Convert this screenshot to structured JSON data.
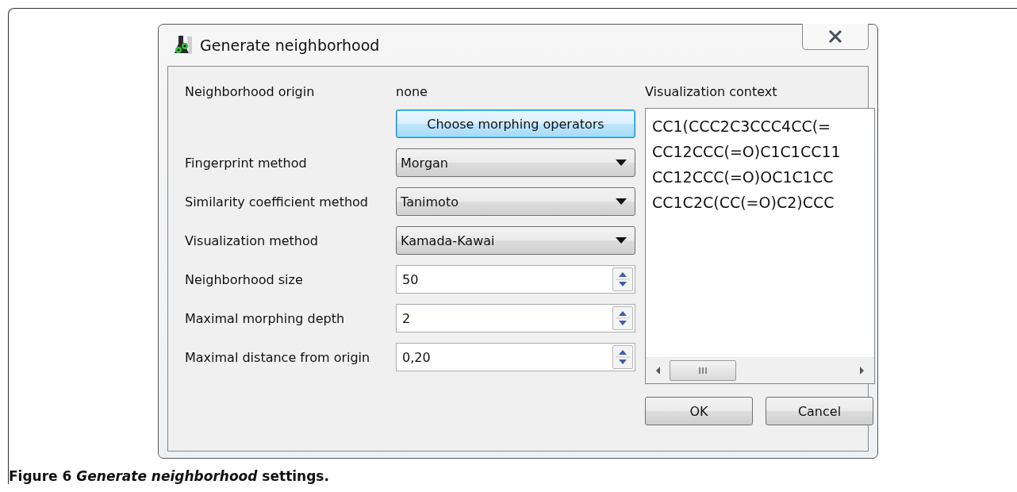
{
  "window": {
    "title": "Generate neighborhood"
  },
  "form": {
    "origin": {
      "label": "Neighborhood origin",
      "value": "none"
    },
    "operators_button": "Choose morphing operators",
    "fields": [
      {
        "kind": "combo",
        "label": "Fingerprint method",
        "value": "Morgan"
      },
      {
        "kind": "combo",
        "label": "Similarity coefficient method",
        "value": "Tanimoto"
      },
      {
        "kind": "combo",
        "label": "Visualization method",
        "value": "Kamada-Kawai"
      },
      {
        "kind": "spin",
        "label": "Neighborhood size",
        "value": "50"
      },
      {
        "kind": "spin",
        "label": "Maximal morphing depth",
        "value": "2"
      },
      {
        "kind": "spin",
        "label": "Maximal distance from origin",
        "value": "0,20"
      }
    ]
  },
  "context": {
    "label": "Visualization context",
    "items": [
      "CC1(CCC2C3CCC4CC(=",
      "CC12CCC(=O)C1C1CC11",
      "CC12CCC(=O)OC1C1CC",
      "CC1C2C(CC(=O)C2)CCC"
    ]
  },
  "buttons": [
    "OK",
    "Cancel"
  ],
  "caption": "Figure 6 *Generate neighborhood* settings."
}
